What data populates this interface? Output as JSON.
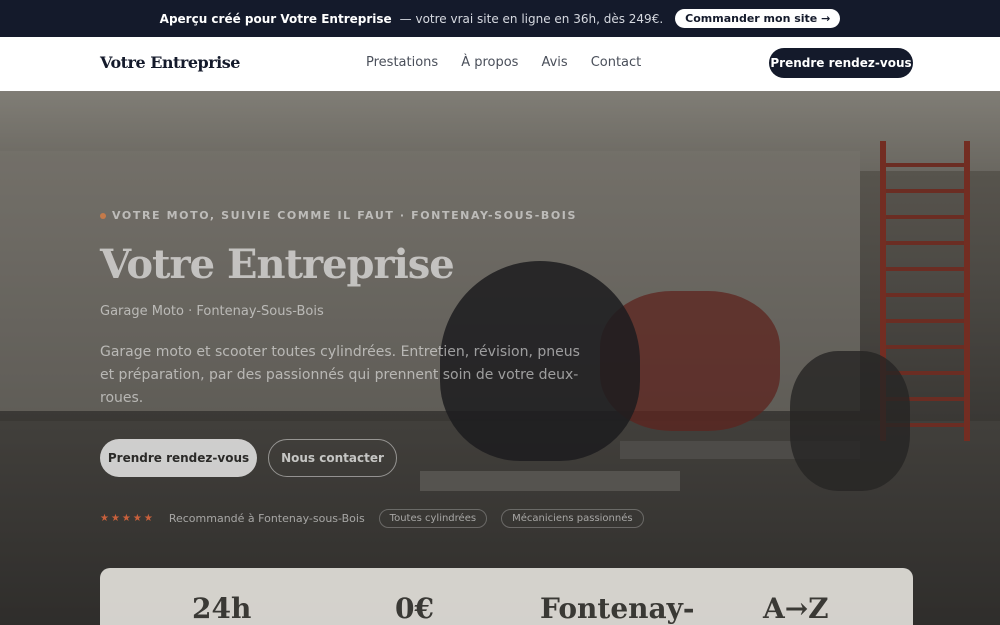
{
  "banner": {
    "lead": "Aperçu créé pour Votre Entreprise",
    "rest": "— votre vrai site en ligne en 36h, dès 249€.",
    "cta": "Commander mon site →"
  },
  "nav": {
    "brand": "Votre Entreprise",
    "links": [
      "Prestations",
      "À propos",
      "Avis",
      "Contact"
    ],
    "cta": "Prendre rendez-vous"
  },
  "hero": {
    "eyebrow": "VOTRE MOTO, SUIVIE COMME IL FAUT · FONTENAY-SOUS-BOIS",
    "title": "Votre Entreprise",
    "subtitle": "Garage Moto · Fontenay-Sous-Bois",
    "description": "Garage moto et scooter toutes cylindrées. Entretien, révision, pneus et préparation, par des passionnés qui prennent soin de votre deux-roues.",
    "primary_cta": "Prendre rendez-vous",
    "secondary_cta": "Nous contacter",
    "stars": "★★★★★",
    "trust_text": "Recommandé à Fontenay-sous-Bois",
    "pills": [
      "Toutes cylindrées",
      "Mécaniciens passionnés"
    ]
  },
  "stats": [
    "24h",
    "0€",
    "Fontenay-",
    "A→Z"
  ],
  "colors": {
    "navy": "#141a2b",
    "accent": "#c9603c"
  }
}
